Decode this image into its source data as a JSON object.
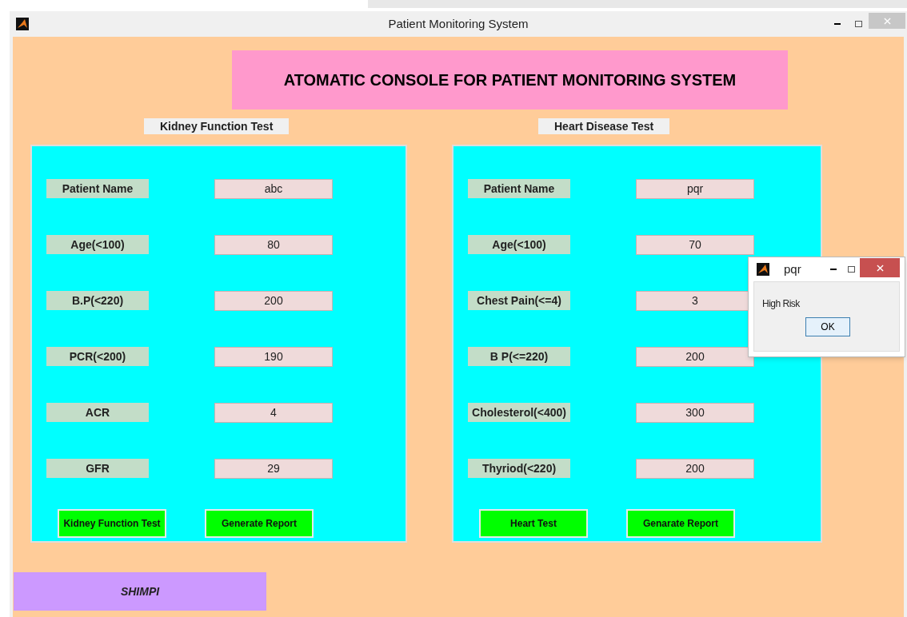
{
  "window": {
    "title": "Patient Monitoring System"
  },
  "banner": "ATOMATIC CONSOLE FOR PATIENT MONITORING SYSTEM",
  "panels": [
    {
      "heading": "Kidney Function Test",
      "fields": [
        {
          "label": "Patient Name",
          "value": "abc"
        },
        {
          "label": "Age(<100)",
          "value": "80"
        },
        {
          "label": "B.P(<220)",
          "value": "200"
        },
        {
          "label": "PCR(<200)",
          "value": "190"
        },
        {
          "label": "ACR",
          "value": "4"
        },
        {
          "label": "GFR",
          "value": "29"
        }
      ],
      "buttons": [
        "Kidney Function Test",
        "Generate Report"
      ]
    },
    {
      "heading": "Heart Disease Test",
      "fields": [
        {
          "label": "Patient Name",
          "value": "pqr"
        },
        {
          "label": "Age(<100)",
          "value": "70"
        },
        {
          "label": "Chest Pain(<=4)",
          "value": "3"
        },
        {
          "label": "B P(<=220)",
          "value": "200"
        },
        {
          "label": "Cholesterol(<400)",
          "value": "300"
        },
        {
          "label": "Thyriod(<220)",
          "value": "200"
        }
      ],
      "buttons": [
        "Heart Test",
        "Genarate Report"
      ]
    }
  ],
  "footer": "SHIMPI",
  "dialog": {
    "title": "pqr",
    "message": "High Risk",
    "button": "OK"
  }
}
